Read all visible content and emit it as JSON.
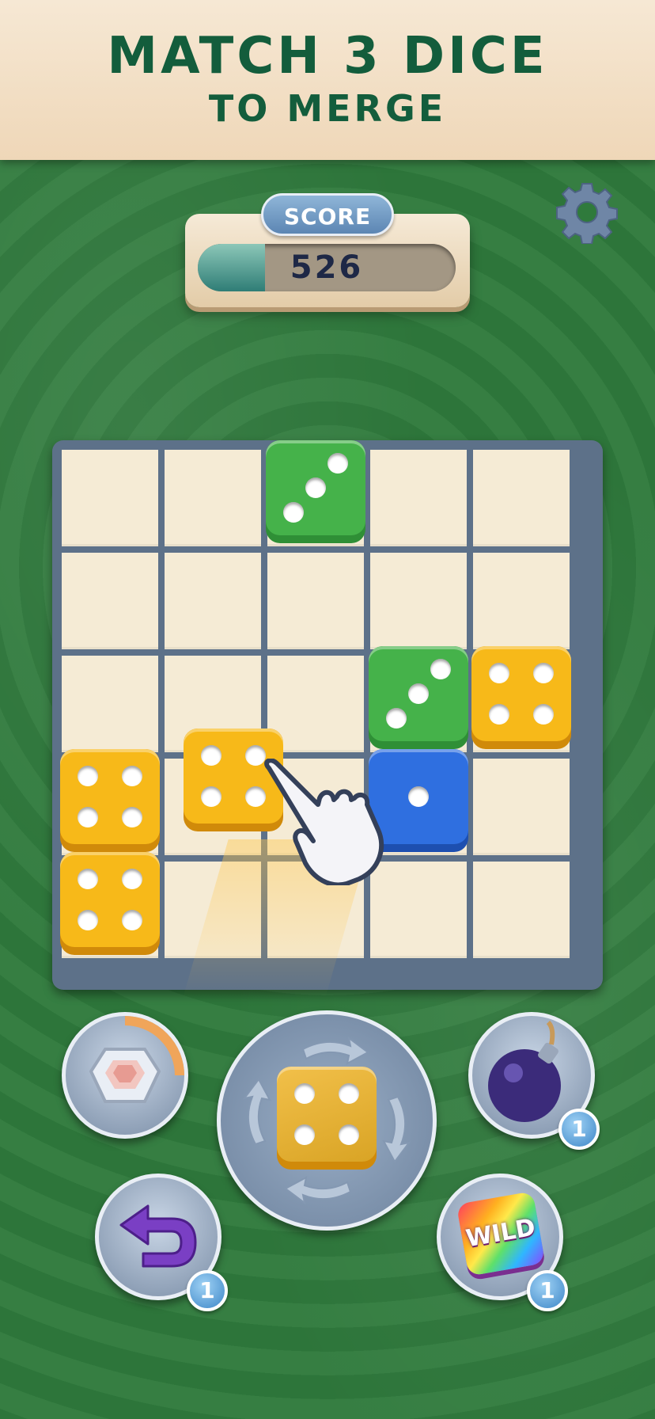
{
  "banner": {
    "line1": "MATCH 3 DICE",
    "line2": "TO MERGE"
  },
  "score": {
    "label": "SCORE",
    "value": "526",
    "progress": 0.26
  },
  "settings": {
    "icon": "gear-icon"
  },
  "board": {
    "rows": 5,
    "cols": 5,
    "dice": [
      {
        "row": 0,
        "col": 2,
        "color": "green",
        "value": 3
      },
      {
        "row": 2,
        "col": 3,
        "color": "green",
        "value": 3
      },
      {
        "row": 2,
        "col": 4,
        "color": "yellow",
        "value": 4
      },
      {
        "row": 3,
        "col": 0,
        "color": "yellow",
        "value": 4
      },
      {
        "row": 3,
        "col": 3,
        "color": "blue",
        "value": 1
      },
      {
        "row": 4,
        "col": 0,
        "color": "yellow",
        "value": 4
      }
    ],
    "dragged_die": {
      "color": "yellow",
      "value": 4
    }
  },
  "next_die": {
    "color": "yellow",
    "value": 4
  },
  "powerups": {
    "gem": {
      "icon": "diamond-icon"
    },
    "bomb": {
      "icon": "bomb-icon",
      "count": "1"
    },
    "undo": {
      "icon": "undo-arrow-icon",
      "count": "1"
    },
    "wild": {
      "label": "WILD",
      "count": "1"
    }
  },
  "colors": {
    "green": "#45b24a",
    "yellow": "#f7b919",
    "blue": "#2f6fe0",
    "board": "#5d7189",
    "banner_text": "#135d3c"
  }
}
